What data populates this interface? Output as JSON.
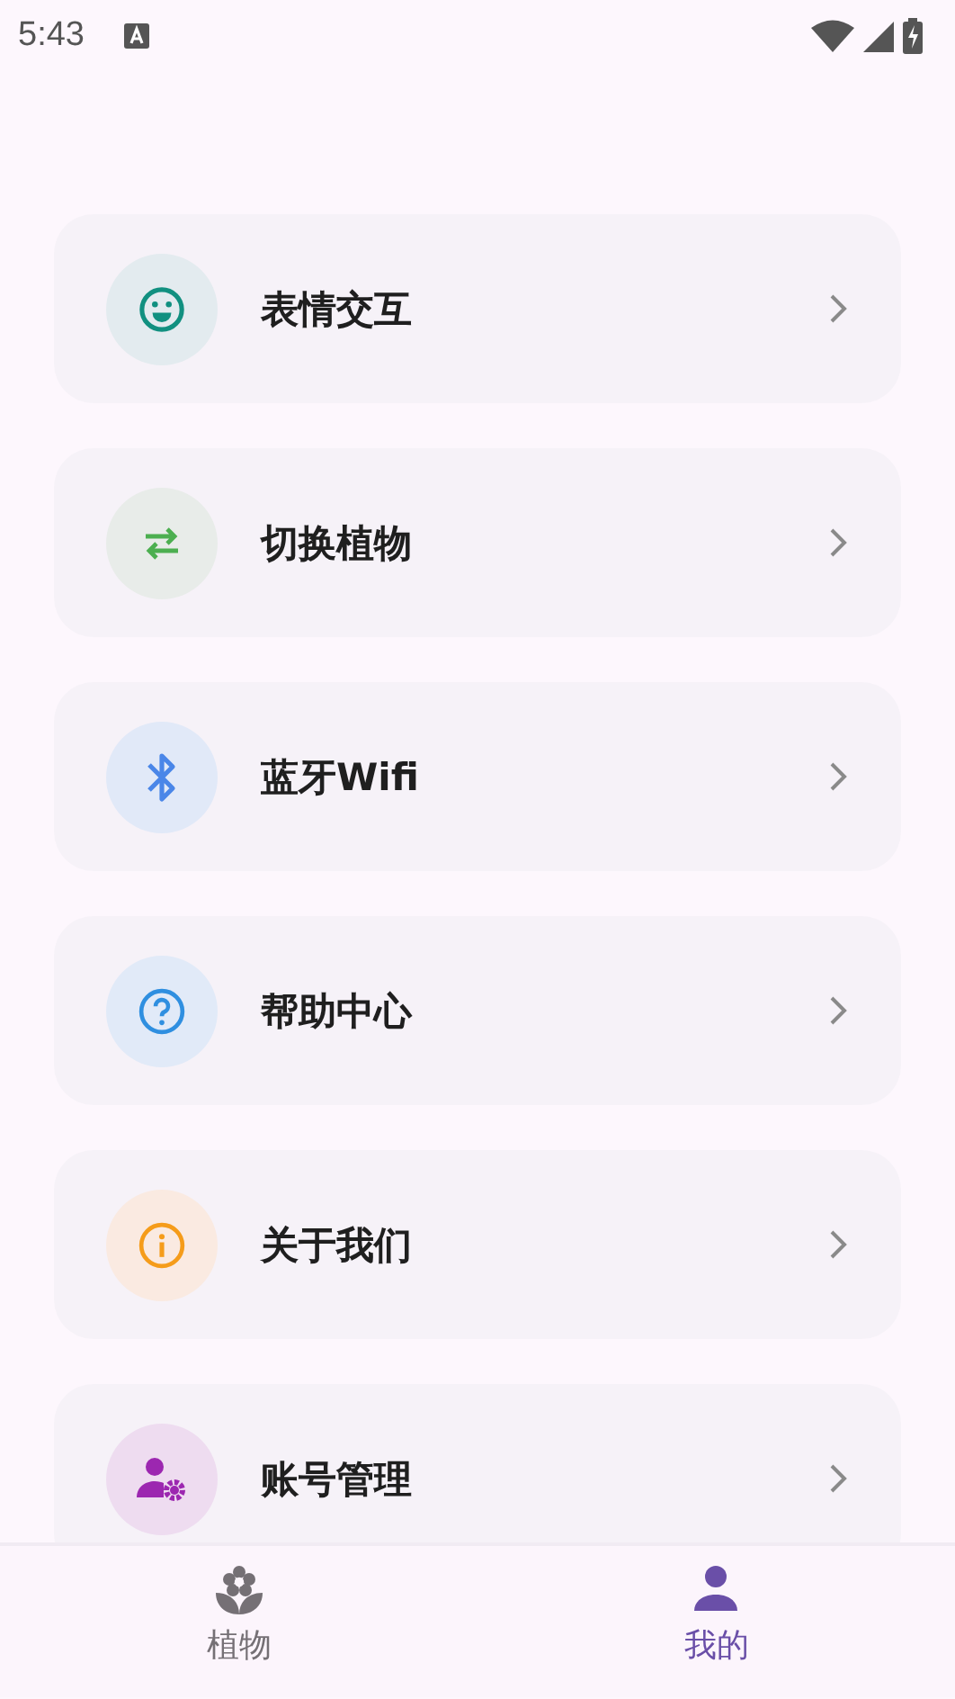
{
  "status_bar": {
    "time": "5:43"
  },
  "menu": [
    {
      "kind": "emoji",
      "label": "表情交互"
    },
    {
      "kind": "swap",
      "label": "切换植物"
    },
    {
      "kind": "bluetooth",
      "label": "蓝牙Wifi"
    },
    {
      "kind": "help",
      "label": "帮助中心"
    },
    {
      "kind": "info",
      "label": "关于我们"
    },
    {
      "kind": "account",
      "label": "账号管理"
    }
  ],
  "bottom_nav": [
    {
      "kind": "plant",
      "label": "植物",
      "selected": false
    },
    {
      "kind": "person",
      "label": "我的",
      "selected": true
    }
  ]
}
